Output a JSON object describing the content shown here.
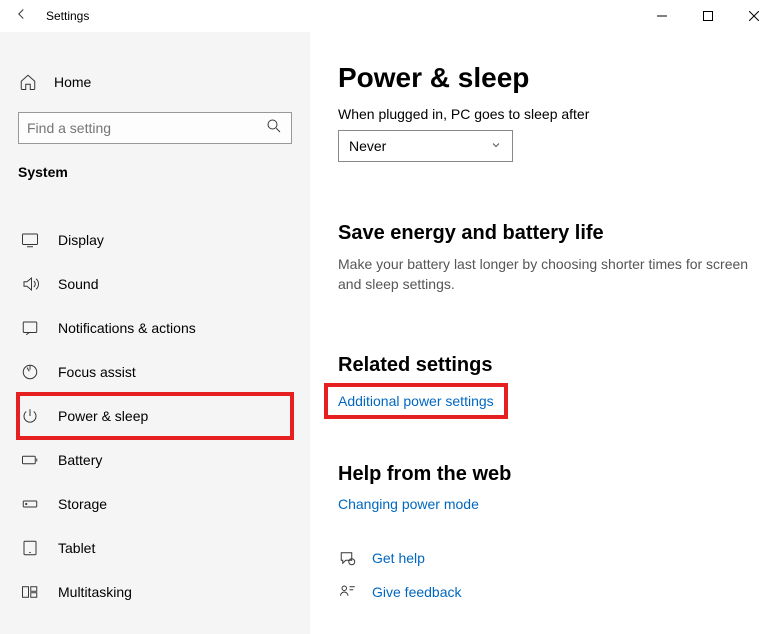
{
  "titlebar": {
    "title": "Settings"
  },
  "sidebar": {
    "home": "Home",
    "search_placeholder": "Find a setting",
    "section": "System",
    "items": [
      {
        "label": "Display"
      },
      {
        "label": "Sound"
      },
      {
        "label": "Notifications & actions"
      },
      {
        "label": "Focus assist"
      },
      {
        "label": "Power & sleep"
      },
      {
        "label": "Battery"
      },
      {
        "label": "Storage"
      },
      {
        "label": "Tablet"
      },
      {
        "label": "Multitasking"
      }
    ]
  },
  "content": {
    "title": "Power & sleep",
    "sleep_label": "When plugged in, PC goes to sleep after",
    "sleep_value": "Never",
    "energy_title": "Save energy and battery life",
    "energy_desc": "Make your battery last longer by choosing shorter times for screen and sleep settings.",
    "related_title": "Related settings",
    "related_link": "Additional power settings",
    "help_title": "Help from the web",
    "help_link": "Changing power mode",
    "get_help": "Get help",
    "give_feedback": "Give feedback"
  }
}
